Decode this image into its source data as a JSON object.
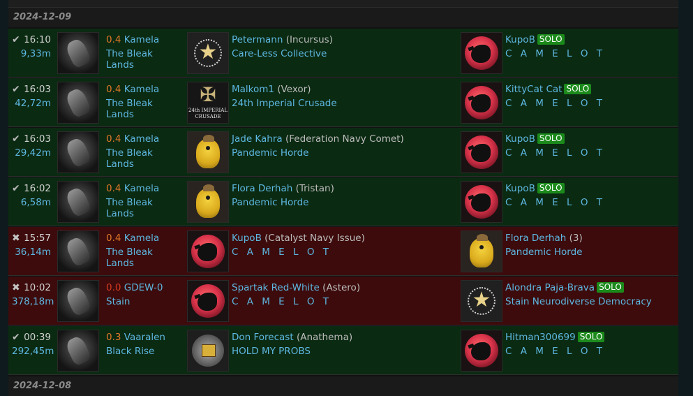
{
  "date_headers": [
    {
      "text": "2024-12-09"
    },
    {
      "text": "2024-12-08"
    }
  ],
  "colors": {
    "win_row": "#0b2a12",
    "loss_row": "#3d0b0c",
    "link": "#5db7e0",
    "security_low": "#e07828",
    "security_null": "#d63a1e",
    "solo_badge": "#1b8a1b"
  },
  "kills": [
    {
      "status": "win",
      "status_icon": "✔",
      "time": "16:10",
      "isk": "9,33m",
      "security": "0.4",
      "system": "Kamela",
      "region": "The Bleak Lands",
      "victim_logo": "star-emblem",
      "victim_pilot": "Petermann",
      "victim_ship": "(Incursus)",
      "victim_corp": "Care-Less Collective",
      "attacker_logo": "camelot-raven-moon",
      "attacker_pilot": "KupoB",
      "attacker_solo": "SOLO",
      "attacker_corp": "C A M E L O T"
    },
    {
      "status": "win",
      "status_icon": "✔",
      "time": "16:03",
      "isk": "42,72m",
      "security": "0.4",
      "system": "Kamela",
      "region": "The Bleak Lands",
      "victim_logo": "imperial-crusade-crest",
      "victim_logo_text": "24th IMPERIAL CRUSADE",
      "victim_pilot": "Malkom1",
      "victim_ship": "(Vexor)",
      "victim_corp": "24th Imperial Crusade",
      "attacker_logo": "camelot-raven-moon",
      "attacker_pilot": "KittyCat Cat",
      "attacker_solo": "SOLO",
      "attacker_corp": "C A M E L O T"
    },
    {
      "status": "win",
      "status_icon": "✔",
      "time": "16:03",
      "isk": "29,42m",
      "security": "0.4",
      "system": "Kamela",
      "region": "The Bleak Lands",
      "victim_logo": "pandemic-horde-bird",
      "victim_pilot": "Jade Kahra",
      "victim_ship": "(Federation Navy Comet)",
      "victim_corp": "Pandemic Horde",
      "attacker_logo": "camelot-raven-moon",
      "attacker_pilot": "KupoB",
      "attacker_solo": "SOLO",
      "attacker_corp": "C A M E L O T"
    },
    {
      "status": "win",
      "status_icon": "✔",
      "time": "16:02",
      "isk": "6,58m",
      "security": "0.4",
      "system": "Kamela",
      "region": "The Bleak Lands",
      "victim_logo": "pandemic-horde-bird",
      "victim_pilot": "Flora Derhah",
      "victim_ship": "(Tristan)",
      "victim_corp": "Pandemic Horde",
      "attacker_logo": "camelot-raven-moon",
      "attacker_pilot": "KupoB",
      "attacker_solo": "SOLO",
      "attacker_corp": "C A M E L O T"
    },
    {
      "status": "loss",
      "status_icon": "✖",
      "time": "15:57",
      "isk": "36,14m",
      "security": "0.4",
      "system": "Kamela",
      "region": "The Bleak Lands",
      "victim_logo": "camelot-raven-moon",
      "victim_pilot": "KupoB",
      "victim_ship": "(Catalyst Navy Issue)",
      "victim_corp": "C A M E L O T",
      "attacker_logo": "pandemic-horde-bird",
      "attacker_pilot": "Flora Derhah",
      "attacker_count": "(3)",
      "attacker_corp": "Pandemic Horde"
    },
    {
      "status": "loss",
      "status_icon": "✖",
      "time": "10:02",
      "isk": "378,18m",
      "security": "0.0",
      "system": "GDEW-0",
      "region": "Stain",
      "victim_logo": "camelot-raven-moon",
      "victim_pilot": "Spartak Red-White",
      "victim_ship": "(Astero)",
      "victim_corp": "C A M E L O T",
      "attacker_logo": "star-emblem",
      "attacker_pilot": "Alondra Paja-Brava",
      "attacker_solo": "SOLO",
      "attacker_corp": "Stain Neurodiverse Democracy"
    },
    {
      "status": "win",
      "status_icon": "✔",
      "time": "00:39",
      "isk": "292,45m",
      "security": "0.3",
      "system": "Vaaralen",
      "region": "Black Rise",
      "victim_logo": "hold-my-probs-emblem",
      "victim_pilot": "Don Forecast",
      "victim_ship": "(Anathema)",
      "victim_corp": "HOLD MY PROBS",
      "attacker_logo": "camelot-raven-moon",
      "attacker_pilot": "Hitman300699",
      "attacker_solo": "SOLO",
      "attacker_corp": "C A M E L O T"
    }
  ]
}
